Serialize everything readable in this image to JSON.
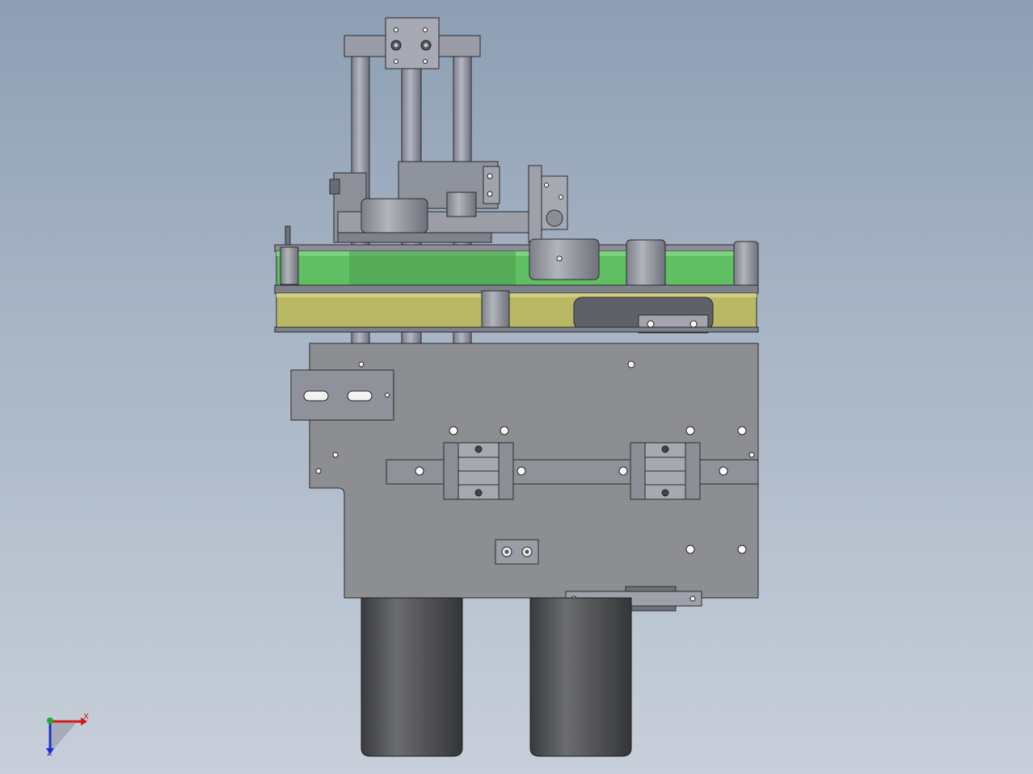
{
  "viewport": {
    "background_top": "#8e9fb4",
    "background_bottom": "#c8cfda"
  },
  "model": {
    "colors": {
      "steel_dark": "#6f737c",
      "steel_mid": "#8a8e97",
      "steel_light": "#a8acb4",
      "rod": "#9a9caa",
      "plate": "#8c8e92",
      "belt_green": "#5fbf62",
      "belt_yellow": "#b9b865",
      "motor_body": "#4c4d50",
      "outline": "#2a2b30"
    }
  },
  "triad": {
    "x_label": "X",
    "z_label": "Z",
    "x_color": "#d11a1a",
    "y_color": "#1ab02a",
    "z_color": "#1a2fd1"
  }
}
